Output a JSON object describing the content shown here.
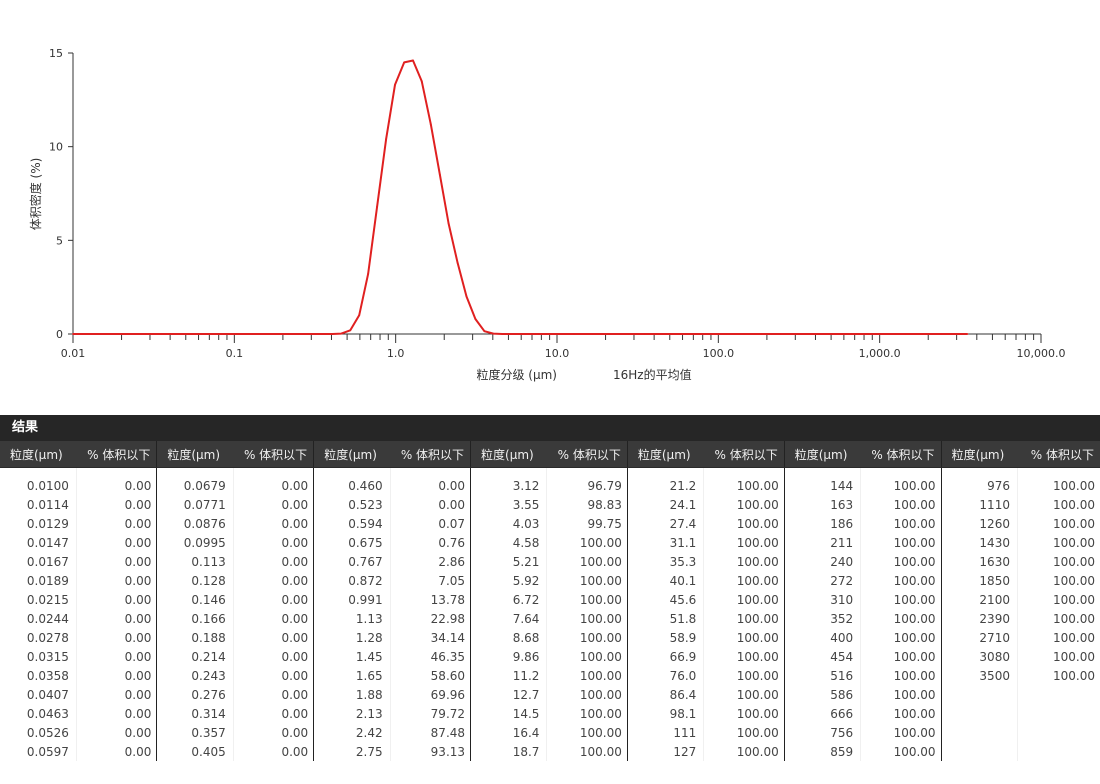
{
  "chart_data": {
    "type": "line",
    "xscale": "log",
    "xlim": [
      0.01,
      10000
    ],
    "ylim": [
      0,
      15
    ],
    "xticks": [
      0.01,
      0.1,
      1,
      10,
      100,
      1000,
      10000
    ],
    "xtick_labels": [
      "0.01",
      "0.1",
      "1.0",
      "10.0",
      "100.0",
      "1,000.0",
      "10,000.0"
    ],
    "yticks": [
      0,
      5,
      10,
      15
    ],
    "ytick_labels": [
      "0",
      "5",
      "10",
      "15"
    ],
    "xlabel": "粒度分级 (μm)",
    "xlabel_suffix": "16Hz的平均值",
    "ylabel": "体积密度 (%)",
    "grid": false,
    "series": [
      {
        "color": "#e02020",
        "x": [
          0.01,
          0.0114,
          0.0129,
          0.0147,
          0.0167,
          0.0189,
          0.0215,
          0.0244,
          0.0278,
          0.0315,
          0.0358,
          0.0407,
          0.0463,
          0.0526,
          0.0597,
          0.0679,
          0.0771,
          0.0876,
          0.0995,
          0.113,
          0.128,
          0.146,
          0.166,
          0.188,
          0.214,
          0.243,
          0.276,
          0.314,
          0.357,
          0.405,
          0.46,
          0.523,
          0.594,
          0.675,
          0.767,
          0.872,
          0.991,
          1.13,
          1.28,
          1.45,
          1.65,
          1.88,
          2.13,
          2.42,
          2.75,
          3.12,
          3.55,
          4.03,
          4.58,
          5.21,
          5.92,
          6.72,
          7.64,
          8.68,
          9.86,
          11.2,
          12.7,
          14.5,
          16.4,
          18.7,
          21.2,
          24.1,
          27.4,
          31.1,
          35.3,
          40.1,
          45.6,
          51.8,
          58.9,
          66.9,
          76.0,
          86.4,
          98.1,
          111,
          127,
          144,
          163,
          186,
          211,
          240,
          272,
          310,
          352,
          400,
          454,
          516,
          586,
          666,
          756,
          859,
          976,
          1110,
          1260,
          1430,
          1630,
          1850,
          2100,
          2390,
          2710,
          3080,
          3500
        ],
        "y": [
          0,
          0,
          0,
          0,
          0,
          0,
          0,
          0,
          0,
          0,
          0,
          0,
          0,
          0,
          0,
          0,
          0,
          0,
          0,
          0,
          0,
          0,
          0,
          0,
          0,
          0,
          0,
          0,
          0,
          0,
          0.02,
          0.2,
          1.0,
          3.2,
          6.8,
          10.4,
          13.3,
          14.5,
          14.6,
          13.5,
          11.2,
          8.5,
          5.9,
          3.8,
          2.0,
          0.8,
          0.15,
          0.02,
          0,
          0,
          0,
          0,
          0,
          0,
          0,
          0,
          0,
          0,
          0,
          0,
          0,
          0,
          0,
          0,
          0,
          0,
          0,
          0,
          0,
          0,
          0,
          0,
          0,
          0,
          0,
          0,
          0,
          0,
          0,
          0,
          0,
          0,
          0,
          0,
          0,
          0,
          0,
          0,
          0,
          0,
          0,
          0,
          0,
          0,
          0,
          0,
          0,
          0,
          0,
          0,
          0
        ]
      }
    ]
  },
  "results": {
    "title": "结果",
    "col_size": "粒度(μm)",
    "col_pct": "% 体积以下",
    "groups": [
      {
        "sizes": [
          "0.0100",
          "0.0114",
          "0.0129",
          "0.0147",
          "0.0167",
          "0.0189",
          "0.0215",
          "0.0244",
          "0.0278",
          "0.0315",
          "0.0358",
          "0.0407",
          "0.0463",
          "0.0526",
          "0.0597"
        ],
        "pcts": [
          "0.00",
          "0.00",
          "0.00",
          "0.00",
          "0.00",
          "0.00",
          "0.00",
          "0.00",
          "0.00",
          "0.00",
          "0.00",
          "0.00",
          "0.00",
          "0.00",
          "0.00"
        ]
      },
      {
        "sizes": [
          "0.0679",
          "0.0771",
          "0.0876",
          "0.0995",
          "0.113",
          "0.128",
          "0.146",
          "0.166",
          "0.188",
          "0.214",
          "0.243",
          "0.276",
          "0.314",
          "0.357",
          "0.405"
        ],
        "pcts": [
          "0.00",
          "0.00",
          "0.00",
          "0.00",
          "0.00",
          "0.00",
          "0.00",
          "0.00",
          "0.00",
          "0.00",
          "0.00",
          "0.00",
          "0.00",
          "0.00",
          "0.00"
        ]
      },
      {
        "sizes": [
          "0.460",
          "0.523",
          "0.594",
          "0.675",
          "0.767",
          "0.872",
          "0.991",
          "1.13",
          "1.28",
          "1.45",
          "1.65",
          "1.88",
          "2.13",
          "2.42",
          "2.75"
        ],
        "pcts": [
          "0.00",
          "0.00",
          "0.07",
          "0.76",
          "2.86",
          "7.05",
          "13.78",
          "22.98",
          "34.14",
          "46.35",
          "58.60",
          "69.96",
          "79.72",
          "87.48",
          "93.13"
        ]
      },
      {
        "sizes": [
          "3.12",
          "3.55",
          "4.03",
          "4.58",
          "5.21",
          "5.92",
          "6.72",
          "7.64",
          "8.68",
          "9.86",
          "11.2",
          "12.7",
          "14.5",
          "16.4",
          "18.7"
        ],
        "pcts": [
          "96.79",
          "98.83",
          "99.75",
          "100.00",
          "100.00",
          "100.00",
          "100.00",
          "100.00",
          "100.00",
          "100.00",
          "100.00",
          "100.00",
          "100.00",
          "100.00",
          "100.00"
        ]
      },
      {
        "sizes": [
          "21.2",
          "24.1",
          "27.4",
          "31.1",
          "35.3",
          "40.1",
          "45.6",
          "51.8",
          "58.9",
          "66.9",
          "76.0",
          "86.4",
          "98.1",
          "111",
          "127"
        ],
        "pcts": [
          "100.00",
          "100.00",
          "100.00",
          "100.00",
          "100.00",
          "100.00",
          "100.00",
          "100.00",
          "100.00",
          "100.00",
          "100.00",
          "100.00",
          "100.00",
          "100.00",
          "100.00"
        ]
      },
      {
        "sizes": [
          "144",
          "163",
          "186",
          "211",
          "240",
          "272",
          "310",
          "352",
          "400",
          "454",
          "516",
          "586",
          "666",
          "756",
          "859"
        ],
        "pcts": [
          "100.00",
          "100.00",
          "100.00",
          "100.00",
          "100.00",
          "100.00",
          "100.00",
          "100.00",
          "100.00",
          "100.00",
          "100.00",
          "100.00",
          "100.00",
          "100.00",
          "100.00"
        ]
      },
      {
        "sizes": [
          "976",
          "1110",
          "1260",
          "1430",
          "1630",
          "1850",
          "2100",
          "2390",
          "2710",
          "3080",
          "3500"
        ],
        "pcts": [
          "100.00",
          "100.00",
          "100.00",
          "100.00",
          "100.00",
          "100.00",
          "100.00",
          "100.00",
          "100.00",
          "100.00",
          "100.00"
        ]
      }
    ]
  }
}
